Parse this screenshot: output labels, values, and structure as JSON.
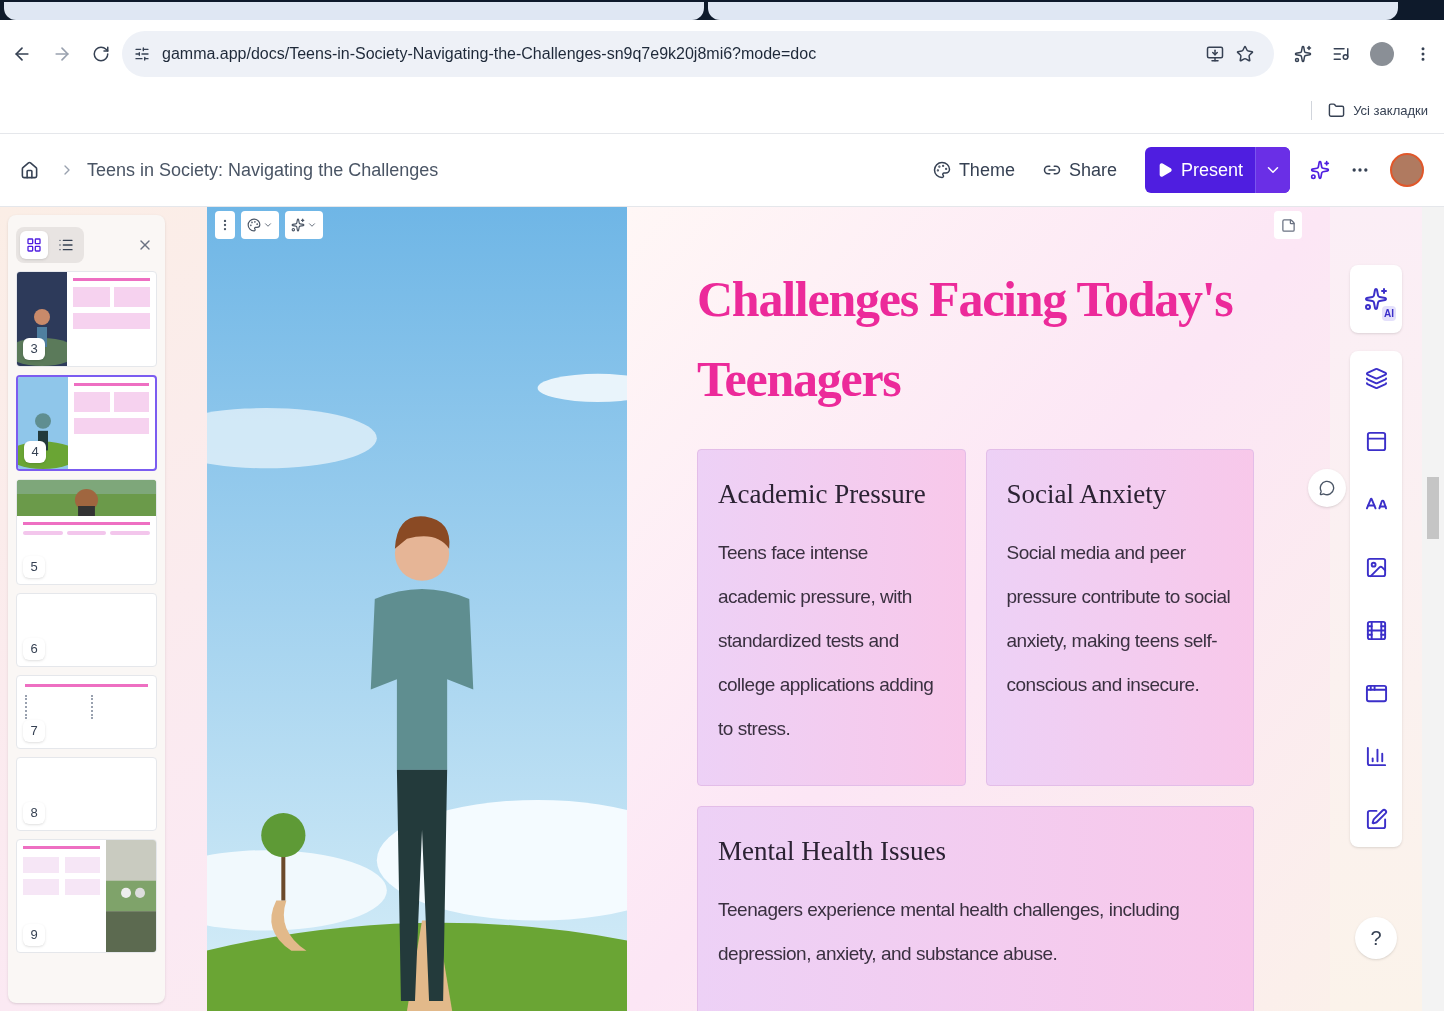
{
  "browser": {
    "url": "gamma.app/docs/Teens-in-Society-Navigating-the-Challenges-sn9q7e9k20j8mi6?mode=doc",
    "bookmarks_label": "Усі закладки"
  },
  "header": {
    "breadcrumb": "Teens in Society: Navigating the Challenges",
    "actions": [
      {
        "kind": "theme",
        "label": "Theme"
      },
      {
        "kind": "share",
        "label": "Share"
      }
    ],
    "present_label": "Present"
  },
  "panel": {
    "views": [
      {
        "kind": "grid",
        "selected": true
      },
      {
        "kind": "list",
        "selected": false
      }
    ],
    "slides": [
      {
        "number": "3",
        "kind": "image-left",
        "selected": false
      },
      {
        "number": "4",
        "kind": "image-left",
        "selected": true
      },
      {
        "number": "5",
        "kind": "banner",
        "selected": false
      },
      {
        "number": "6",
        "kind": "blank",
        "selected": false
      },
      {
        "number": "7",
        "kind": "bullets",
        "selected": false
      },
      {
        "number": "8",
        "kind": "blank",
        "selected": false
      },
      {
        "number": "9",
        "kind": "image-right",
        "selected": false
      }
    ]
  },
  "slide": {
    "title": "Challenges Facing Today's Teenagers",
    "cards": [
      {
        "title": "Academic Pressure",
        "body": "Teens face intense academic pressure, with standardized tests and college applications adding to stress."
      },
      {
        "title": "Social Anxiety",
        "body": "Social media and peer pressure contribute to social anxiety, making teens self-conscious and insecure."
      },
      {
        "title": "Mental Health Issues",
        "body": "Teenagers experience mental health challenges, including depression, anxiety, and substance abuse."
      }
    ]
  },
  "toolbar": {
    "ai_label": "AI",
    "help_label": "?"
  }
}
